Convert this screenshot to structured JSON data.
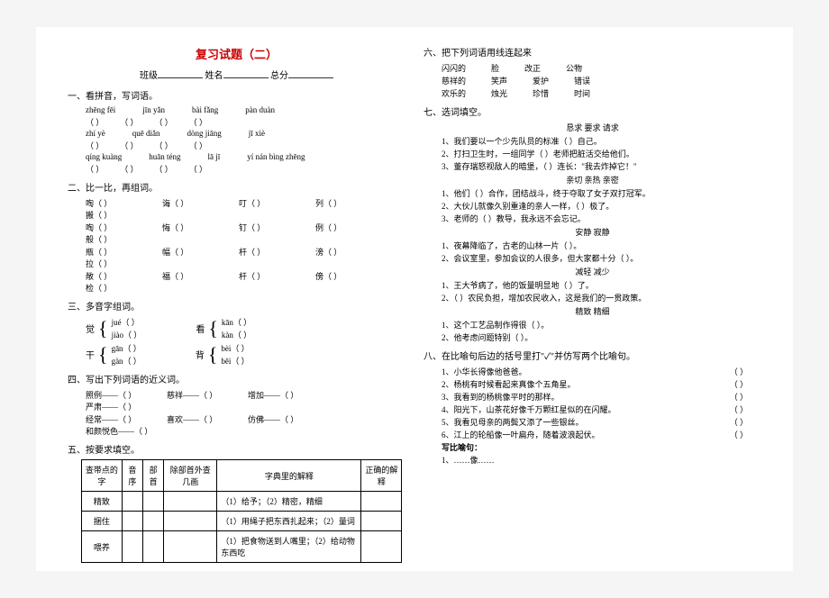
{
  "title": "复习试题（二）",
  "header": {
    "class_label": "班级",
    "name_label": "姓名",
    "score_label": "总分"
  },
  "s1": {
    "title": "一、看拼音，写词语。",
    "r1": [
      "zhēng fēi",
      "jīn yǎn",
      "bài fǎng",
      "pàn duàn"
    ],
    "r2": [
      "zhí yè",
      "quē diǎn",
      "dòng jiāng",
      "jī xiè"
    ],
    "r3": [
      "qíng kuàng",
      "huān téng",
      "lā jī",
      "yí nán bìng zhēng"
    ],
    "paren": "（        ）"
  },
  "s2": {
    "title": "二、比一比，再组词。",
    "rows": [
      [
        "啕（     ）",
        "诲（     ）",
        "叮（     ）",
        "列（     ）",
        "搬（     ）"
      ],
      [
        "啕（     ）",
        "悔（     ）",
        "钉（     ）",
        "例（     ）",
        "般（     ）"
      ],
      [
        "瓶（     ）",
        "幅（     ）",
        "杆（     ）",
        "滂（     ）",
        "拉（     ）"
      ],
      [
        "敞（     ）",
        "福（     ）",
        "杆（     ）",
        "傍（     ）",
        "检（     ）"
      ]
    ]
  },
  "s3": {
    "title": "三、多音字组词。",
    "items": [
      {
        "char": "觉",
        "a": "jué（      ）",
        "b": "jiào（      ）"
      },
      {
        "char": "看",
        "a": "kān（      ）",
        "b": "kàn（      ）"
      },
      {
        "char": "干",
        "a": "gān（      ）",
        "b": "gàn（      ）"
      },
      {
        "char": "背",
        "a": "bèi（      ）",
        "b": "bēi（      ）"
      }
    ]
  },
  "s4": {
    "title": "四、写出下列词语的近义词。",
    "rows": [
      [
        "照例——（    ）",
        "慈祥——（    ）",
        "增加——（    ）",
        "严肃——（    ）"
      ],
      [
        "经常——（    ）",
        "喜欢——（    ）",
        "仿佛——（    ）",
        "和颜悦色——（    ）"
      ]
    ]
  },
  "s5": {
    "title": "五、按要求填空。",
    "headers": [
      "查带点的字",
      "音序",
      "部首",
      "除部首外查几画",
      "字典里的解释",
      "正确的解释"
    ],
    "rows": [
      {
        "w": "精致",
        "def": "（1）给予；（2）精密，精细"
      },
      {
        "w": "捆住",
        "def": "（1）用绳子把东西扎起来；（2）量词"
      },
      {
        "w": "喂养",
        "def": "（1）把食物送到人嘴里；（2）给动物东西吃"
      }
    ]
  },
  "s6": {
    "title": "六、把下列词语用线连起来",
    "left": [
      "闪闪的",
      "慈祥的",
      "欢乐的"
    ],
    "mid": [
      "脸",
      "笑声",
      "烛光"
    ],
    "r1": [
      "改正",
      "爱护",
      "珍惜"
    ],
    "r2": [
      "公物",
      "错误",
      "时间"
    ]
  },
  "s7": {
    "title": "七、选词填空。",
    "g1": {
      "bank": "恳求    要求    请求",
      "q": [
        "1、我们要以一个少先队员的标准（      ）自己。",
        "2、打扫卫生时，一组同学（      ）老师把脏活交给他们。",
        "3、董存瑞怒视敌人的暗堡，（      ）连长：\"我去炸掉它！\""
      ]
    },
    "g2": {
      "bank": "亲切    亲热    亲密",
      "q": [
        "1、他们（      ）合作，团结战斗，终于夺取了女子双打冠军。",
        "2、大伙儿就像久别重逢的亲人一样，（      ）极了。",
        "3、老师的（      ）教导，我永远不会忘记。"
      ]
    },
    "g3": {
      "bank": "安静    寂静",
      "q": [
        "1、夜幕降临了，古老的山林一片（      ）。",
        "2、会议室里，参加会议的人很多，但大家都十分（      ）。"
      ]
    },
    "g4": {
      "bank": "减轻    减少",
      "q": [
        "1、王大爷病了，他的饭量明显地（      ）了。",
        "2、（      ）农民负担，增加农民收入，这是我们的一贯政策。"
      ]
    },
    "g5": {
      "bank": "精致    精细",
      "q": [
        "1、这个工艺品制作得很（      ）。",
        "2、他考虑问题特别（      ）。"
      ]
    }
  },
  "s8": {
    "title": "八、在比喻句后边的括号里打\"✓\"并仿写两个比喻句。",
    "items": [
      "1、小华长得像他爸爸。",
      "2、杨桃有时候看起来真像个五角星。",
      "3、我看到的杨桃像平时的那样。",
      "4、阳光下，山茶花好像千万颗红星似的在闪耀。",
      "5、我看见母亲的两鬓又添了一些银丝。",
      "6、江上的轮船像一叶扁舟，随着波浪起伏。"
    ],
    "write_label": "写比喻句：",
    "write_line": "1、……像……"
  }
}
